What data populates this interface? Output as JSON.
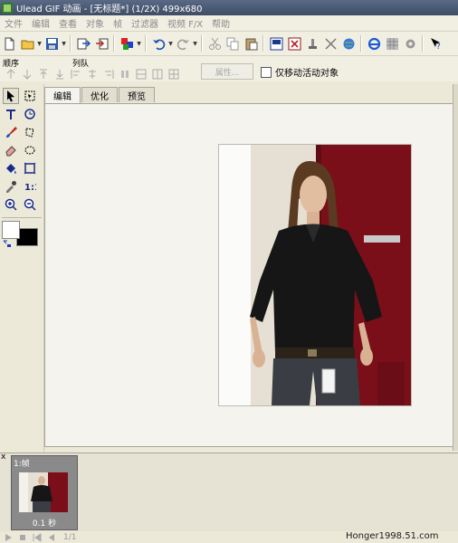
{
  "window": {
    "title": "Ulead GIF 动画 - [无标题*] (1/2X) 499x680"
  },
  "menu": {
    "items": [
      "文件",
      "编辑",
      "查看",
      "对象",
      "帧",
      "过滤器",
      "视频 F/X",
      "帮助"
    ]
  },
  "toolbar": {
    "icons": [
      "new-file-icon",
      "open-folder-icon",
      "save-icon",
      "import-icon",
      "export-icon",
      "color-icon",
      "undo-icon",
      "redo-icon",
      "cut-icon",
      "copy-icon",
      "paste-icon",
      "image-icon",
      "delete-icon",
      "stamp-icon",
      "transform-icon",
      "globe-icon",
      "ie-icon",
      "grid-icon",
      "gear-icon",
      "help-icon"
    ]
  },
  "toolbar2": {
    "order_label": "顺序",
    "queue_label": "列队",
    "properties_label": "属性...",
    "move_active_only_label": "仅移动活动对象",
    "move_active_only_checked": false
  },
  "tools": [
    "pointer",
    "crop",
    "text",
    "transform",
    "paint-brush",
    "lasso",
    "eraser",
    "ellipse-select",
    "fill-bucket",
    "grab",
    "eyedropper",
    "actual-size",
    "zoom-in",
    "zoom-out"
  ],
  "colors": {
    "foreground": "#ffffff",
    "background": "#000000"
  },
  "tabs": [
    {
      "label": "编辑",
      "active": true
    },
    {
      "label": "优化",
      "active": false
    },
    {
      "label": "预览",
      "active": false
    }
  ],
  "frames": {
    "panel_close": "x",
    "items": [
      {
        "label": "1:帧",
        "delay": "0.1 秒"
      }
    ],
    "frame_indicator": "1/1"
  },
  "watermark": "Honger1998.51.com"
}
